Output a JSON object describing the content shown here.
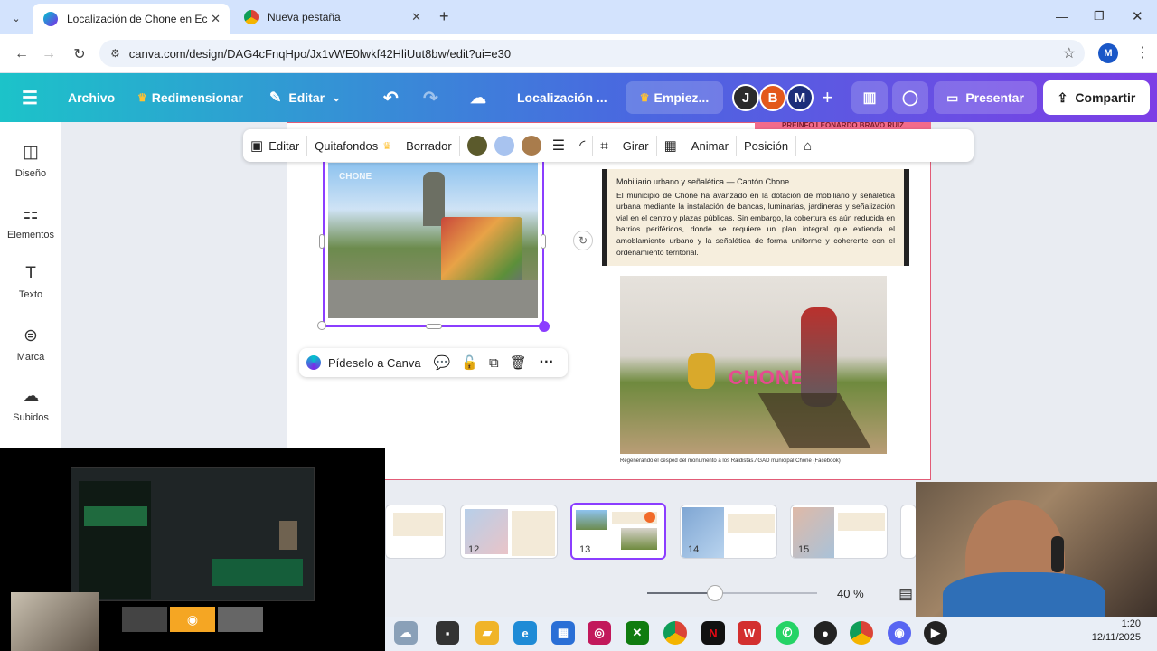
{
  "browser": {
    "tabs": [
      {
        "title": "Localización de Chone en Ecua",
        "active": true
      },
      {
        "title": "Nueva pestaña",
        "active": false
      }
    ],
    "new_tab": "+",
    "url": "canva.com/design/DAG4cFnqHpo/Jx1vWE0lwkf42HliUut8bw/edit?ui=e30",
    "profile_initial": "M"
  },
  "canva": {
    "menu": {
      "archivo": "Archivo",
      "redimensionar": "Redimensionar",
      "editar": "Editar",
      "doc_title": "Localización ...",
      "empiezo": "Empiez...",
      "presentar": "Presentar",
      "compartir": "Compartir"
    },
    "collaborators": [
      "J",
      "B",
      "M"
    ],
    "sidebar": [
      {
        "label": "Diseño",
        "icon": "design-icon"
      },
      {
        "label": "Elementos",
        "icon": "elements-icon"
      },
      {
        "label": "Texto",
        "icon": "text-icon"
      },
      {
        "label": "Marca",
        "icon": "brand-icon"
      },
      {
        "label": "Subidos",
        "icon": "upload-icon"
      }
    ],
    "image_toolbar": {
      "editar": "Editar",
      "quitafondos": "Quitafondos",
      "borrador": "Borrador",
      "girar": "Girar",
      "animar": "Animar",
      "posicion": "Posición"
    },
    "swatches": [
      "#5b5a2c",
      "#a8c3ef",
      "#a97c4c"
    ],
    "ribbon_text": "PREINFO LEONARDO BRAVO RUIZ",
    "pide": "Pídeselo a Canva",
    "slide": {
      "photo1_watermark": "CHONE",
      "heading": "Mobiliario urbano y señalética — Cantón Chone",
      "body": "El municipio de Chone ha avanzado en la dotación de mobiliario y señalética urbana mediante la instalación de bancas, luminarias, jardineras y señalización vial en el centro y plazas públicas. Sin embargo, la cobertura es aún reducida en barrios periféricos, donde se requiere un plan integral que extienda el amoblamiento urbano y la señalética de forma uniforme y coherente con el ordenamiento territorial.",
      "photo2_letters": "CHONE",
      "caption": "Regenerando el césped del monumento a los Raidistas./ GAD municipal Chone (Facebook)"
    },
    "thumbnails": [
      {
        "num": ""
      },
      {
        "num": "12"
      },
      {
        "num": "13"
      },
      {
        "num": "14"
      },
      {
        "num": "15"
      }
    ],
    "zoom": {
      "level": 0.4,
      "label": "40 %"
    }
  },
  "taskbar": {
    "time": "1:20",
    "date": "12/11/2025"
  }
}
